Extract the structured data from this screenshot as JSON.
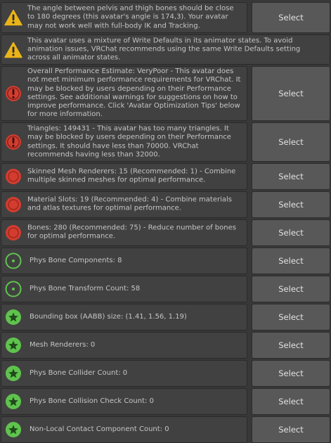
{
  "colors": {
    "panel_bg": "#383838",
    "message_bg": "#414141",
    "button_bg": "#585858",
    "warning_yellow": "#e9b319",
    "error_red": "#d23d30",
    "info_green": "#5fc34e"
  },
  "validation_list": {
    "button_label": "Select",
    "items": [
      {
        "level": "warning",
        "icon": "warning-icon",
        "has_button": true,
        "text": "The angle between pelvis and thigh bones should be close to 180 degrees (this avatar's angle is 174,3). Your avatar may not work well with full-body IK and Tracking."
      },
      {
        "level": "warning",
        "icon": "warning-icon",
        "has_button": false,
        "text": "This avatar uses a mixture of Write Defaults in its animator states. To avoid animation issues, VRChat recommends using the same Write Defaults setting across all animator states."
      },
      {
        "level": "error",
        "icon": "error-icon",
        "has_button": true,
        "text": "Overall Performance Estimate: VeryPoor - This avatar does not meet minimum performance requirements for VRChat. It may be blocked by users depending on their Performance settings. See additional warnings for suggestions on how to improve performance. Click 'Avatar Optimization Tips' below for more information."
      },
      {
        "level": "error",
        "icon": "error-icon",
        "has_button": true,
        "text": "Triangles: 149431 - This avatar has too many triangles. It may be blocked by users depending on their Performance settings. It should have less than 70000. VRChat recommends having less than 32000."
      },
      {
        "level": "poor",
        "icon": "red-circle-icon",
        "has_button": true,
        "text": "Skinned Mesh Renderers: 15 (Recommended: 1) - Combine multiple skinned meshes for optimal performance."
      },
      {
        "level": "poor",
        "icon": "red-circle-icon",
        "has_button": true,
        "text": "Material Slots: 19 (Recommended: 4) - Combine materials and atlas textures for optimal performance."
      },
      {
        "level": "poor",
        "icon": "red-circle-icon",
        "has_button": true,
        "text": "Bones: 280 (Recommended: 75) - Reduce number of bones for optimal performance."
      },
      {
        "level": "good",
        "icon": "green-ring-icon",
        "has_button": true,
        "text": "Phys Bone Components: 8"
      },
      {
        "level": "good",
        "icon": "green-ring-icon",
        "has_button": true,
        "text": "Phys Bone Transform Count: 58"
      },
      {
        "level": "excellent",
        "icon": "green-star-icon",
        "has_button": true,
        "text": "Bounding box (AABB) size: (1.41, 1.56, 1.19)"
      },
      {
        "level": "excellent",
        "icon": "green-star-icon",
        "has_button": true,
        "text": "Mesh Renderers: 0"
      },
      {
        "level": "excellent",
        "icon": "green-star-icon",
        "has_button": true,
        "text": "Phys Bone Collider Count: 0"
      },
      {
        "level": "excellent",
        "icon": "green-star-icon",
        "has_button": true,
        "text": "Phys Bone Collision Check Count: 0"
      },
      {
        "level": "excellent",
        "icon": "green-star-icon",
        "has_button": true,
        "text": "Non-Local Contact Component Count: 0"
      }
    ]
  }
}
